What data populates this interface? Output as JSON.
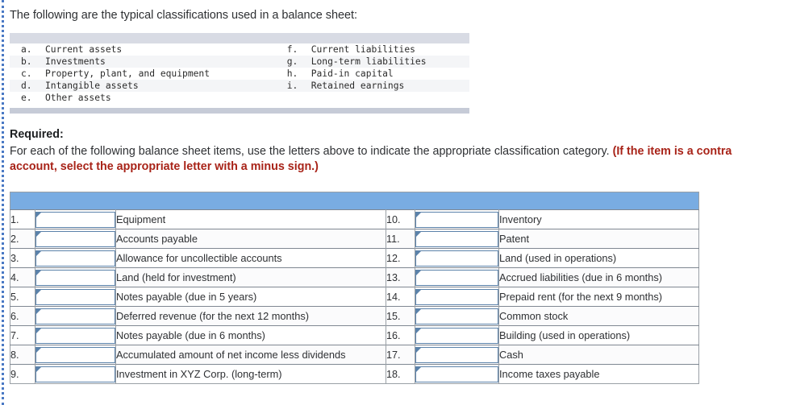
{
  "intro": {
    "text": "The following are the typical classifications used in a balance sheet:"
  },
  "classifications": {
    "left": [
      {
        "letter": "a.",
        "label": "Current assets"
      },
      {
        "letter": "b.",
        "label": "Investments"
      },
      {
        "letter": "c.",
        "label": "Property, plant, and equipment"
      },
      {
        "letter": "d.",
        "label": "Intangible assets"
      },
      {
        "letter": "e.",
        "label": "Other assets"
      }
    ],
    "right": [
      {
        "letter": "f.",
        "label": "Current liabilities"
      },
      {
        "letter": "g.",
        "label": "Long-term liabilities"
      },
      {
        "letter": "h.",
        "label": "Paid-in capital"
      },
      {
        "letter": "i.",
        "label": "Retained earnings"
      },
      {
        "letter": "",
        "label": ""
      }
    ]
  },
  "required": {
    "heading": "Required:",
    "instruction": "For each of the following balance sheet items, use the letters above to indicate the appropriate classification category. ",
    "note": "(If the item is a contra account, select the appropriate letter with a minus sign.)"
  },
  "answer_table": {
    "header_label": "",
    "left_items": [
      {
        "num": "1.",
        "answer": "",
        "description": "Equipment"
      },
      {
        "num": "2.",
        "answer": "",
        "description": "Accounts payable"
      },
      {
        "num": "3.",
        "answer": "",
        "description": "Allowance for uncollectible accounts"
      },
      {
        "num": "4.",
        "answer": "",
        "description": "Land (held for investment)"
      },
      {
        "num": "5.",
        "answer": "",
        "description": "Notes payable (due in 5 years)"
      },
      {
        "num": "6.",
        "answer": "",
        "description": "Deferred revenue (for the next 12 months)"
      },
      {
        "num": "7.",
        "answer": "",
        "description": "Notes payable (due in 6 months)"
      },
      {
        "num": "8.",
        "answer": "",
        "description": "Accumulated amount of net income less dividends"
      },
      {
        "num": "9.",
        "answer": "",
        "description": "Investment in XYZ Corp. (long-term)"
      }
    ],
    "right_items": [
      {
        "num": "10.",
        "answer": "",
        "description": "Inventory"
      },
      {
        "num": "11.",
        "answer": "",
        "description": "Patent"
      },
      {
        "num": "12.",
        "answer": "",
        "description": "Land (used in operations)"
      },
      {
        "num": "13.",
        "answer": "",
        "description": "Accrued liabilities (due in 6 months)"
      },
      {
        "num": "14.",
        "answer": "",
        "description": "Prepaid rent (for the next 9 months)"
      },
      {
        "num": "15.",
        "answer": "",
        "description": "Common stock"
      },
      {
        "num": "16.",
        "answer": "",
        "description": "Building (used in operations)"
      },
      {
        "num": "17.",
        "answer": "",
        "description": "Cash"
      },
      {
        "num": "18.",
        "answer": "",
        "description": "Income taxes payable"
      }
    ]
  },
  "colors": {
    "header_blue": "#79ace2",
    "band_grey": "#d8dbe4",
    "note_red": "#a82318",
    "input_border": "#5b82aa",
    "rule_blue": "#4a79c4"
  }
}
